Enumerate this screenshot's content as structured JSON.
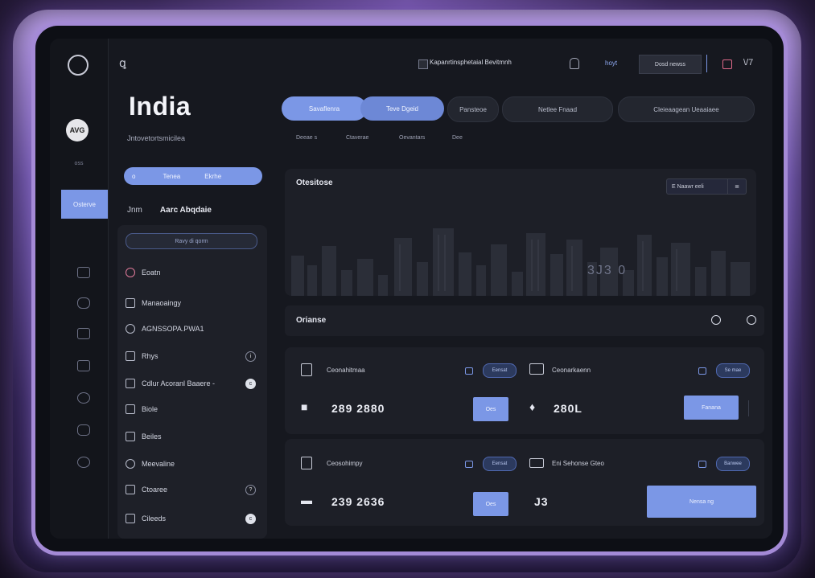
{
  "header": {
    "glyph": "ꝗ",
    "checkbox_title": "Kapanrtinsphetaial Bevitmnh",
    "link": "hoyt",
    "button": "Dosd newss",
    "icon_right": "\\/7"
  },
  "left": {
    "country": "India",
    "country_sub": "Jntovetortsmicilea",
    "avatar_text": "AVG",
    "rail_small": "oss",
    "rail_active": "Osterve",
    "filter": {
      "a": "o",
      "b": "Tenea",
      "c": "Ekrhe"
    },
    "tabs": {
      "first": "Jnm",
      "second": "Aarc Abqdaie"
    },
    "search": "Ravy di qorm",
    "items": [
      {
        "label": "Eoatn",
        "badge": ""
      },
      {
        "label": "Manaoaingy",
        "badge": ""
      },
      {
        "label": "AGNSSOPA.PWA1",
        "badge": ""
      },
      {
        "label": "Rhys",
        "badge": "i"
      },
      {
        "label": "Cdlur Acoranl Baaere -",
        "badge": "c"
      },
      {
        "label": "Biole",
        "badge": ""
      },
      {
        "label": "Beiles",
        "badge": ""
      },
      {
        "label": "Meevaline",
        "badge": ""
      },
      {
        "label": "Ctoaree",
        "badge": "?"
      },
      {
        "label": "Cileeds",
        "badge": "c"
      }
    ]
  },
  "tabs": [
    {
      "label": "Savaflenra",
      "active": true
    },
    {
      "label": "Teve  Dgeid",
      "active": true
    },
    {
      "label": "Pansteoe",
      "active": false
    },
    {
      "label": "Netlee      Fnaad",
      "active": false
    },
    {
      "label": "Cleieaagean    Ueaaiaee",
      "active": false
    }
  ],
  "subtabs": [
    "Deeae s",
    "Ctaverae",
    "Oevantars",
    "Dee"
  ],
  "chart": {
    "title": "Otesitose",
    "control": "E Naawr  eeli",
    "control_icon": "≣",
    "value": "3J3 0"
  },
  "row": {
    "label": "Orianse"
  },
  "metrics": [
    {
      "left_label": "Ceonahitmaa",
      "left_pill": "Eensat",
      "left_value": "289 2880",
      "left_btn": "Oes",
      "right_label": "Ceonarkaenn",
      "right_pill": "Se mae",
      "right_value": "280L",
      "right_btn": "Fanana"
    },
    {
      "left_label": "Ceosohimpy",
      "left_pill": "Eensat",
      "left_value": "239 2636",
      "left_btn": "Oes",
      "right_label": "Eni Sehonse Gteo",
      "right_pill": "Banwee",
      "right_value": "J3",
      "right_btn": "Nensa ng"
    }
  ],
  "colors": {
    "accent": "#7b97e6",
    "panel": "#1d1f27",
    "frame": "#a48ad6"
  }
}
